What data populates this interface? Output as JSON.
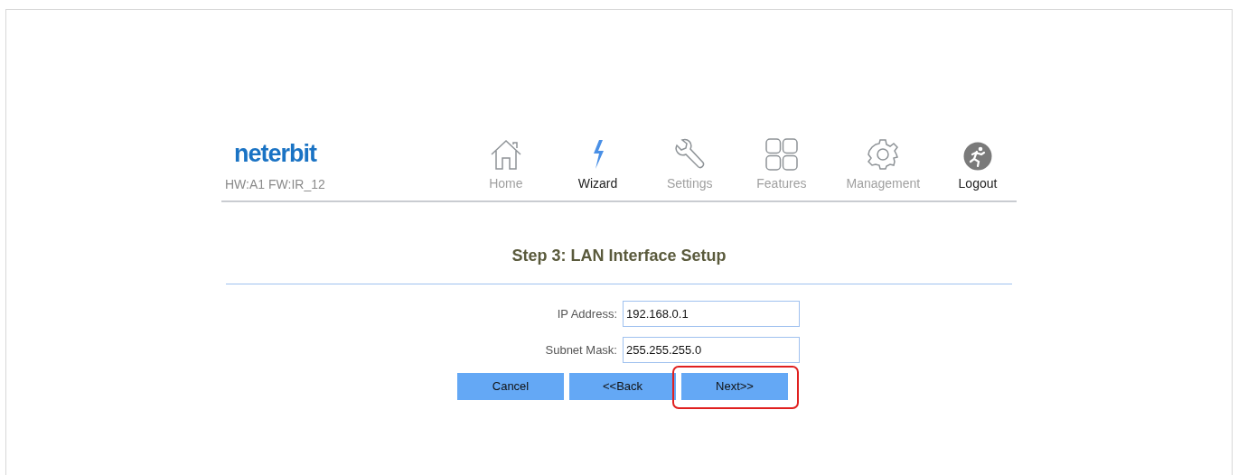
{
  "brand": {
    "logo": "neterbit",
    "version": "HW:A1 FW:IR_12"
  },
  "nav": [
    {
      "kind": "home",
      "label": "Home",
      "selected": false
    },
    {
      "kind": "wizard",
      "label": "Wizard",
      "selected": true
    },
    {
      "kind": "settings",
      "label": "Settings",
      "selected": false
    },
    {
      "kind": "features",
      "label": "Features",
      "selected": false
    },
    {
      "kind": "management",
      "label": "Management",
      "selected": false
    },
    {
      "kind": "logout",
      "label": "Logout",
      "selected": false
    }
  ],
  "title": "Step 3: LAN Interface Setup",
  "fields": [
    {
      "label": "IP Address:",
      "value": "192.168.0.1"
    },
    {
      "label": "Subnet Mask:",
      "value": "255.255.255.0"
    }
  ],
  "buttons": [
    {
      "label": "Cancel",
      "highlighted": false
    },
    {
      "label": "<<Back",
      "highlighted": false
    },
    {
      "label": "Next>>",
      "highlighted": true
    }
  ]
}
